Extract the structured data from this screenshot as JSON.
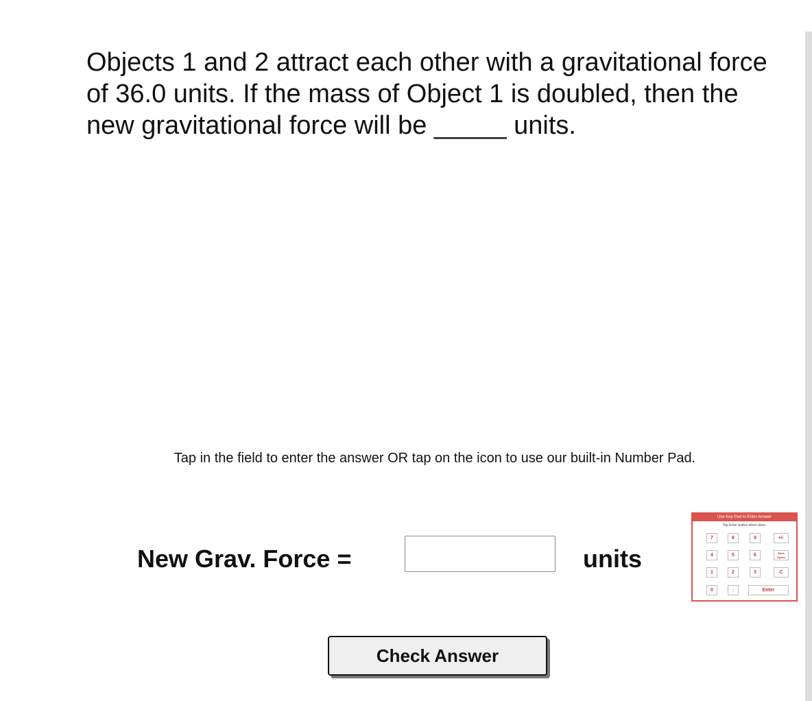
{
  "question": {
    "text": "Objects 1 and 2 attract each other with a gravitational force of 36.0 units. If the mass of Object 1 is doubled, then the new gravitational force will be _____ units."
  },
  "instruction": "Tap in the field to enter the answer OR tap on the icon to use our built-in Number Pad.",
  "answer": {
    "label": "New Grav. Force =",
    "value": "",
    "units": "units"
  },
  "keypad": {
    "title": "Use Key Pad to Enter Answer",
    "subtitle": "Tap Enter button when done.",
    "keys": {
      "k7": "7",
      "k8": "8",
      "k9": "9",
      "plusminus": "+/-",
      "k4": "4",
      "k5": "5",
      "k6": "6",
      "backspace": "Back Space",
      "k1": "1",
      "k2": "2",
      "k3": "3",
      "clear": "C",
      "k0": "0",
      "dot": ".",
      "enter": "Enter"
    },
    "accent_color": "#d9534f"
  },
  "check_button": {
    "label": "Check Answer"
  }
}
